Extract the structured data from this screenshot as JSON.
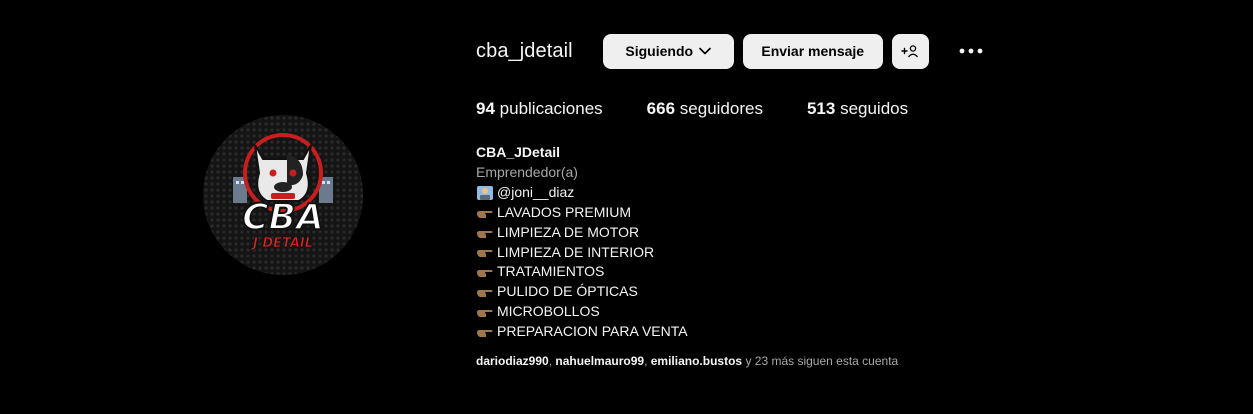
{
  "profile": {
    "username": "cba_jdetail",
    "display_name": "CBA_JDetail",
    "category": "Emprendedor(a)",
    "avatar_logo": {
      "big_text": "CBA",
      "small_text": "J DETAIL",
      "icon": "bulldog-logo"
    }
  },
  "actions": {
    "following_label": "Siguiendo",
    "message_label": "Enviar mensaje",
    "add_user_label": "+",
    "more_icon": "more-horizontal-icon"
  },
  "stats": {
    "posts_count": "94",
    "posts_label": "publicaciones",
    "followers_count": "666",
    "followers_label": "seguidores",
    "following_count": "513",
    "following_label": "seguidos"
  },
  "bio": {
    "mention": "@joni__diaz",
    "services": [
      "LAVADOS PREMIUM",
      "LIMPIEZA DE MOTOR",
      "LIMPIEZA DE INTERIOR",
      "TRATAMIENTOS",
      "PULIDO DE ÓPTICAS",
      "MICROBOLLOS",
      "PREPARACION PARA VENTA"
    ]
  },
  "followed_by": {
    "user1": "dariodiaz990",
    "sep1": ", ",
    "user2": "nahuelmauro99",
    "sep2": ", ",
    "user3": "emiliano.bustos",
    "suffix": " y 23 más siguen esta cuenta"
  },
  "colors": {
    "background": "#000000",
    "button": "#efefef",
    "muted": "#a8a8a8",
    "text": "#f5f5f5",
    "accent_red": "#e02424"
  }
}
